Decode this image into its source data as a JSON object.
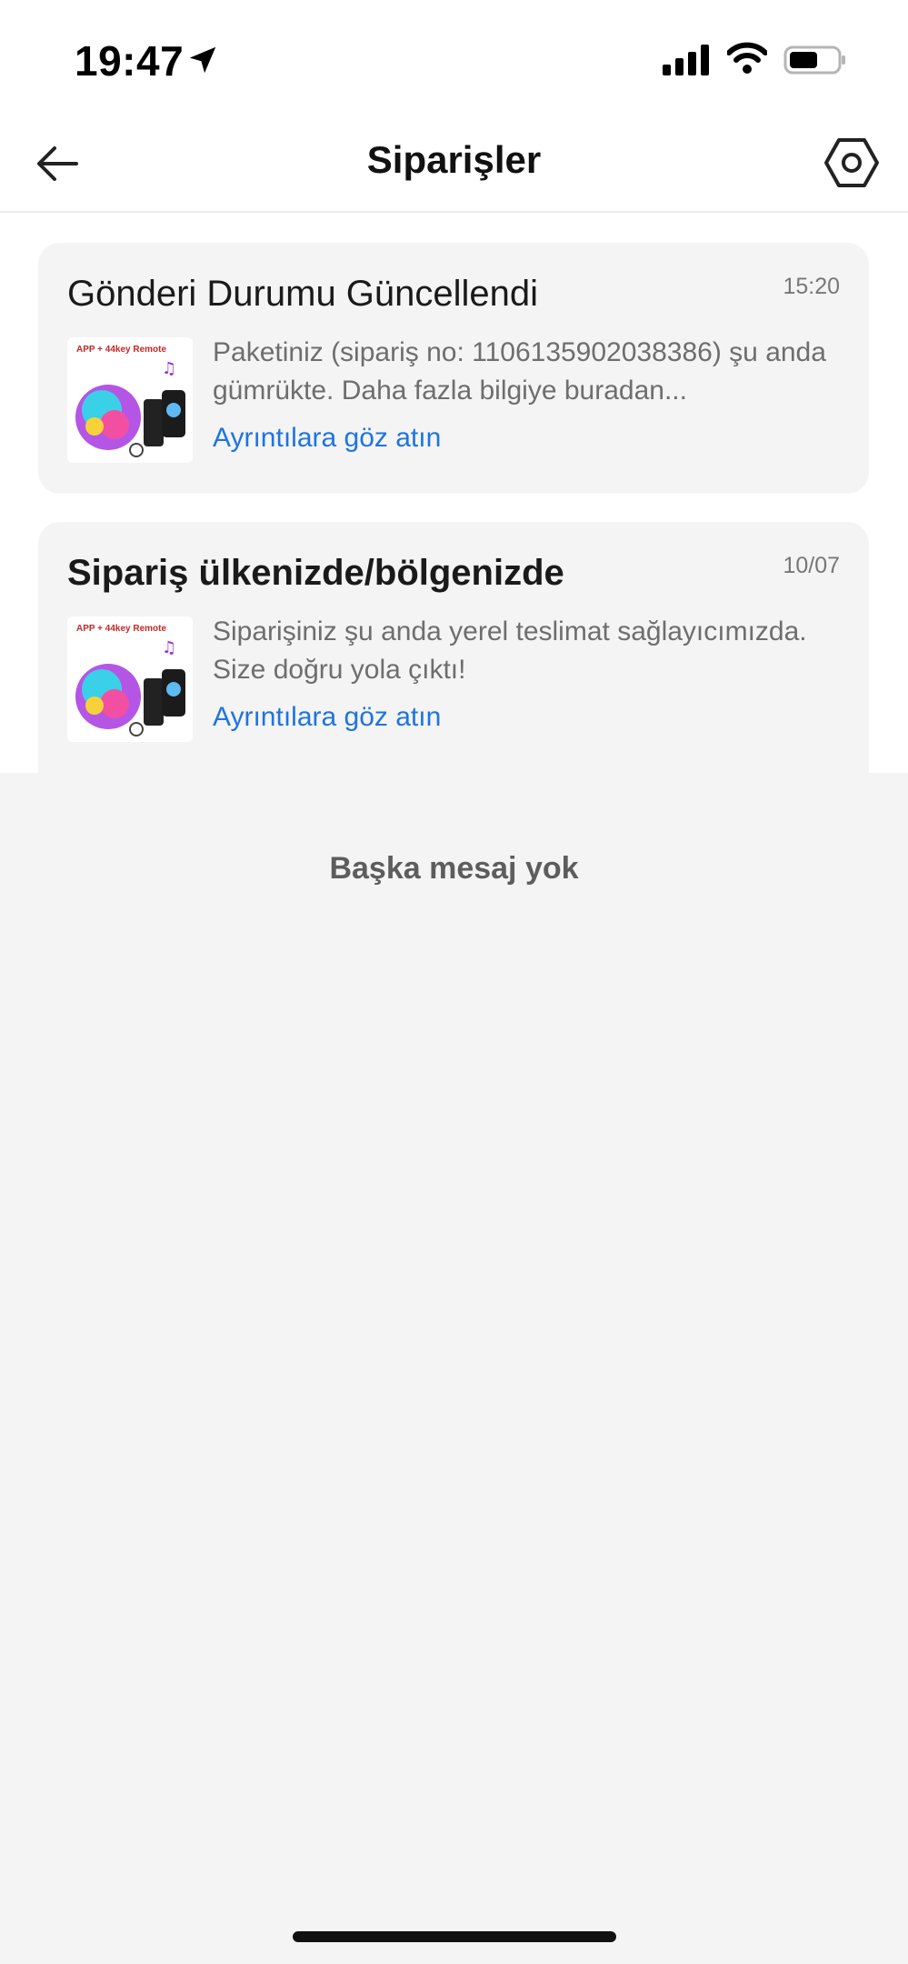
{
  "status_bar": {
    "time": "19:47",
    "icons": [
      "location-arrow-icon",
      "cellular-signal-icon",
      "wifi-icon",
      "battery-icon"
    ]
  },
  "nav": {
    "title": "Siparişler",
    "back_icon": "arrow-left-icon",
    "settings_icon": "hexagon-gear-icon"
  },
  "messages": [
    {
      "title": "Gönderi Durumu Güncellendi",
      "time": "15:20",
      "body": "Paketiniz (sipariş no: 1106135902038386) şu anda gümrükte. Daha fazla bilgiye buradan...",
      "link": "Ayrıntılara göz atın",
      "thumbnail_caption": "APP + 44key Remote"
    },
    {
      "title": "Sipariş ülkenizde/bölgenizde",
      "time": "10/07",
      "body": "Siparişiniz şu anda yerel teslimat sağlayıcımızda. Size doğru yola çıktı!",
      "link": "Ayrıntılara göz atın",
      "thumbnail_caption": "APP + 44key Remote"
    }
  ],
  "footer": {
    "no_more_text": "Başka mesaj yok"
  },
  "colors": {
    "link": "#1e74e0",
    "card_bg": "#f4f4f4",
    "page_bg": "#f4f4f4"
  }
}
